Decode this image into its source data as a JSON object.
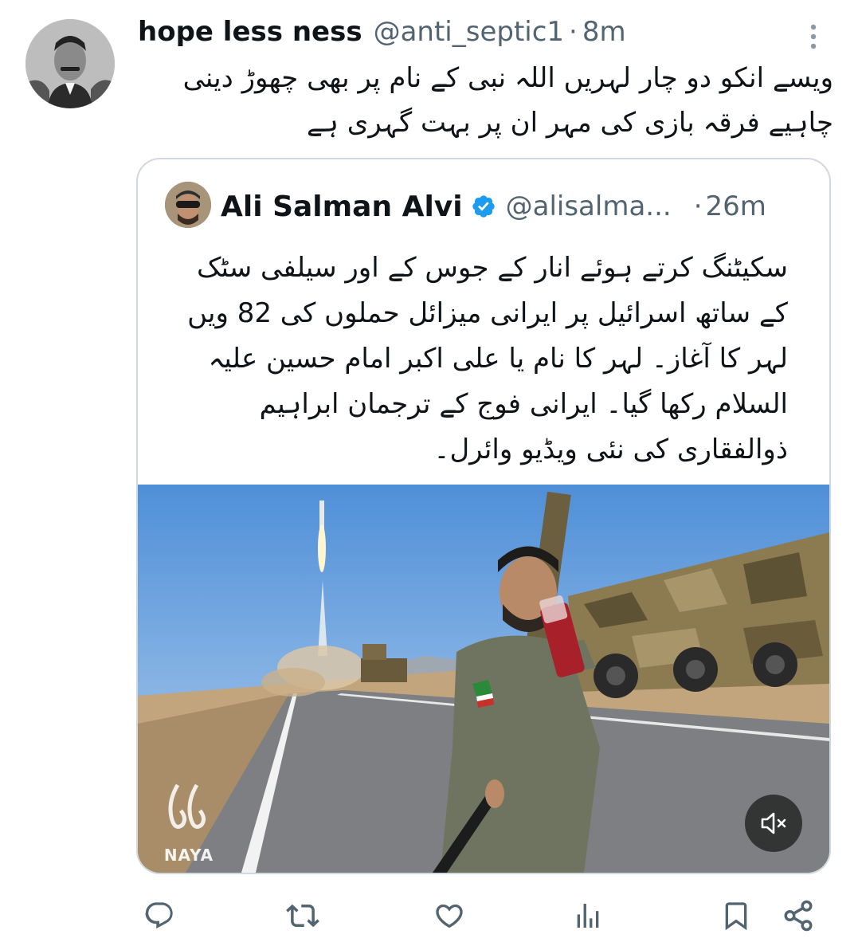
{
  "tweet": {
    "author_name": "hope less ness",
    "author_handle": "@anti_septic1",
    "separator": "·",
    "time": "8m",
    "text": "ویسے انکو دو چار لہریں اللہ نبی کے نام پر بھی چھوڑ دینی چاہیے فرقہ بازی کی مہر ان پر بہت گہری ہے"
  },
  "quoted": {
    "author_name": "Ali Salman Alvi",
    "author_handle": "@alisalma...",
    "separator": "·",
    "time": "26m",
    "text": "سکیٹنگ کرتے ہوئے انار کے جوس کے اور سیلفی سٹک کے ساتھ اسرائیل پر ایرانی میزائل حملوں کی 82 ویں لہر کا آغاز۔ لہر کا نام یا علی اکبر امام حسین علیہ السلام رکھا گیا۔ ایرانی فوج کے ترجمان ابراہیم ذوالفقاری کی نئی ویڈیو وائرل۔",
    "media": {
      "watermark": "NAYA",
      "mute_icon": "volume-muted-icon"
    }
  },
  "actions": [
    "reply-icon",
    "retweet-icon",
    "like-icon",
    "views-icon",
    "bookmark-icon",
    "share-icon"
  ],
  "colors": {
    "text": "#0f1419",
    "secondary": "#536471",
    "border": "#cfd9de",
    "verified": "#1d9bf0"
  }
}
